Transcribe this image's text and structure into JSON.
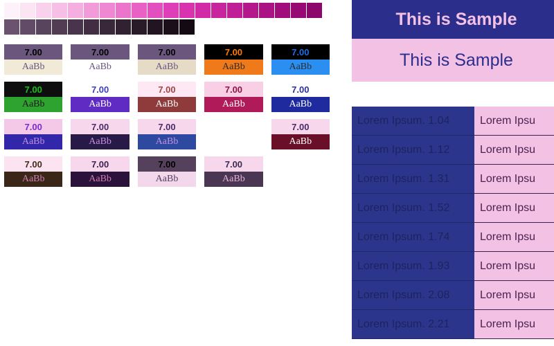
{
  "ramp_light": [
    "#fdf2fa",
    "#fce5f3",
    "#fad1ec",
    "#f8bfe6",
    "#f5aee0",
    "#f29bd9",
    "#ef88d3",
    "#ec75cc",
    "#e862c6",
    "#e44fbf",
    "#df3eb9",
    "#d933b0",
    "#d12ba7",
    "#c8249e",
    "#bf1e96",
    "#b5188d",
    "#ab1385",
    "#a10e7c",
    "#970a74",
    "#8d066c"
  ],
  "ramp_dark": [
    "#6b536f",
    "#624b66",
    "#59445d",
    "#513c54",
    "#49354b",
    "#412e42",
    "#39273a",
    "#312131",
    "#2a1b29",
    "#221521",
    "#1b0f1a",
    "#140a13"
  ],
  "swatches": [
    [
      {
        "ratio": "7.00",
        "ratio_bg": "#6b577d",
        "ratio_fg": "#000000",
        "sample_bg": "#f1ead7",
        "sample_fg": "#6b577d"
      },
      {
        "ratio": "7.00",
        "ratio_bg": "#6b577d",
        "ratio_fg": "#000000",
        "sample_bg": "#ffffff",
        "sample_fg": "#6b577d"
      },
      {
        "ratio": "7.00",
        "ratio_bg": "#6b577d",
        "ratio_fg": "#000000",
        "sample_bg": "#e5dbc7",
        "sample_fg": "#6b577d"
      },
      {
        "ratio": "7.00",
        "ratio_bg": "#000000",
        "ratio_fg": "#ff7a00",
        "sample_bg": "#f07a1a",
        "sample_fg": "#2b2b2b"
      },
      {
        "ratio": "7.00",
        "ratio_bg": "#000000",
        "ratio_fg": "#1e6fe6",
        "sample_bg": "#2b8ff2",
        "sample_fg": "#2b2b2b"
      }
    ],
    [
      {
        "ratio": "7.00",
        "ratio_bg": "#0e0e0e",
        "ratio_fg": "#17c21c",
        "sample_bg": "#2fa32f",
        "sample_fg": "#1a1a1a"
      },
      {
        "ratio": "7.00",
        "ratio_bg": "#ffffff",
        "ratio_fg": "#3a3fbf",
        "sample_bg": "#5f2bc2",
        "sample_fg": "#ffffff"
      },
      {
        "ratio": "7.00",
        "ratio_bg": "#fde8f3",
        "ratio_fg": "#a34343",
        "sample_bg": "#8f3b3b",
        "sample_fg": "#ffffff"
      },
      {
        "ratio": "7.00",
        "ratio_bg": "#f8cfe5",
        "ratio_fg": "#8e1346",
        "sample_bg": "#b01a58",
        "sample_fg": "#ffffff"
      },
      {
        "ratio": "7.00",
        "ratio_bg": "#ffffff",
        "ratio_fg": "#2a2fa3",
        "sample_bg": "#1f2a9e",
        "sample_fg": "#ffffff"
      }
    ],
    [
      {
        "ratio": "7.00",
        "ratio_bg": "#f3c9e7",
        "ratio_fg": "#7b2bd4",
        "sample_bg": "#3127a8",
        "sample_fg": "#c38fe0"
      },
      {
        "ratio": "7.00",
        "ratio_bg": "#f7d7ec",
        "ratio_fg": "#4a2b6a",
        "sample_bg": "#281a47",
        "sample_fg": "#c38fe0"
      },
      {
        "ratio": "7.00",
        "ratio_bg": "#f7d7ec",
        "ratio_fg": "#4a2b6a",
        "sample_bg": "#2d4aa0",
        "sample_fg": "#c38fe0"
      },
      null,
      {
        "ratio": "7.00",
        "ratio_bg": "#f7d7ec",
        "ratio_fg": "#4a2b6a",
        "sample_bg": "#6a0f28",
        "sample_fg": "#ffffff"
      }
    ],
    [
      {
        "ratio": "7.00",
        "ratio_bg": "#fbe3f1",
        "ratio_fg": "#3f2b1a",
        "sample_bg": "#3a2718",
        "sample_fg": "#ce7fb3"
      },
      {
        "ratio": "7.00",
        "ratio_bg": "#f7d7ec",
        "ratio_fg": "#3a2151",
        "sample_bg": "#2a123b",
        "sample_fg": "#ce7fb3"
      },
      {
        "ratio": "7.00",
        "ratio_bg": "#55415c",
        "ratio_fg": "#000000",
        "sample_bg": "#f3d7eb",
        "sample_fg": "#55415c"
      },
      {
        "ratio": "7.00",
        "ratio_bg": "#f7d7ec",
        "ratio_fg": "#3a2b51",
        "sample_bg": "#4a3552",
        "sample_fg": "#e6b3d6"
      },
      null
    ]
  ],
  "sample_text": "AaBb",
  "right": {
    "header1": {
      "bg": "#2c2e8c",
      "fg": "#f2c1e4",
      "text": "This is Sample"
    },
    "header2": {
      "bg": "#f2c1e4",
      "fg": "#2c2e8c",
      "text": "This is Sample"
    },
    "col1_bg": "#2c358c",
    "col2_bg": "#f2c1e4",
    "col1_fg": "#1d235e",
    "col2_fg": "#4a2151",
    "col1_border": "#202766",
    "col2_border": "#3f2151",
    "rows_col1": [
      "Lorem Ipsum. 1.04",
      "Lorem Ipsum. 1.12",
      "Lorem Ipsum. 1.31",
      "Lorem Ipsum. 1.52",
      "Lorem Ipsum. 1.74",
      "Lorem Ipsum. 1.93",
      "Lorem Ipsum. 2.08",
      "Lorem Ipsum. 2.21"
    ],
    "rows_col2": [
      "Lorem Ipsu",
      "Lorem Ipsu",
      "Lorem Ipsu",
      "Lorem Ipsu",
      "Lorem Ipsu",
      "Lorem Ipsu",
      "Lorem Ipsu",
      "Lorem Ipsu"
    ]
  }
}
